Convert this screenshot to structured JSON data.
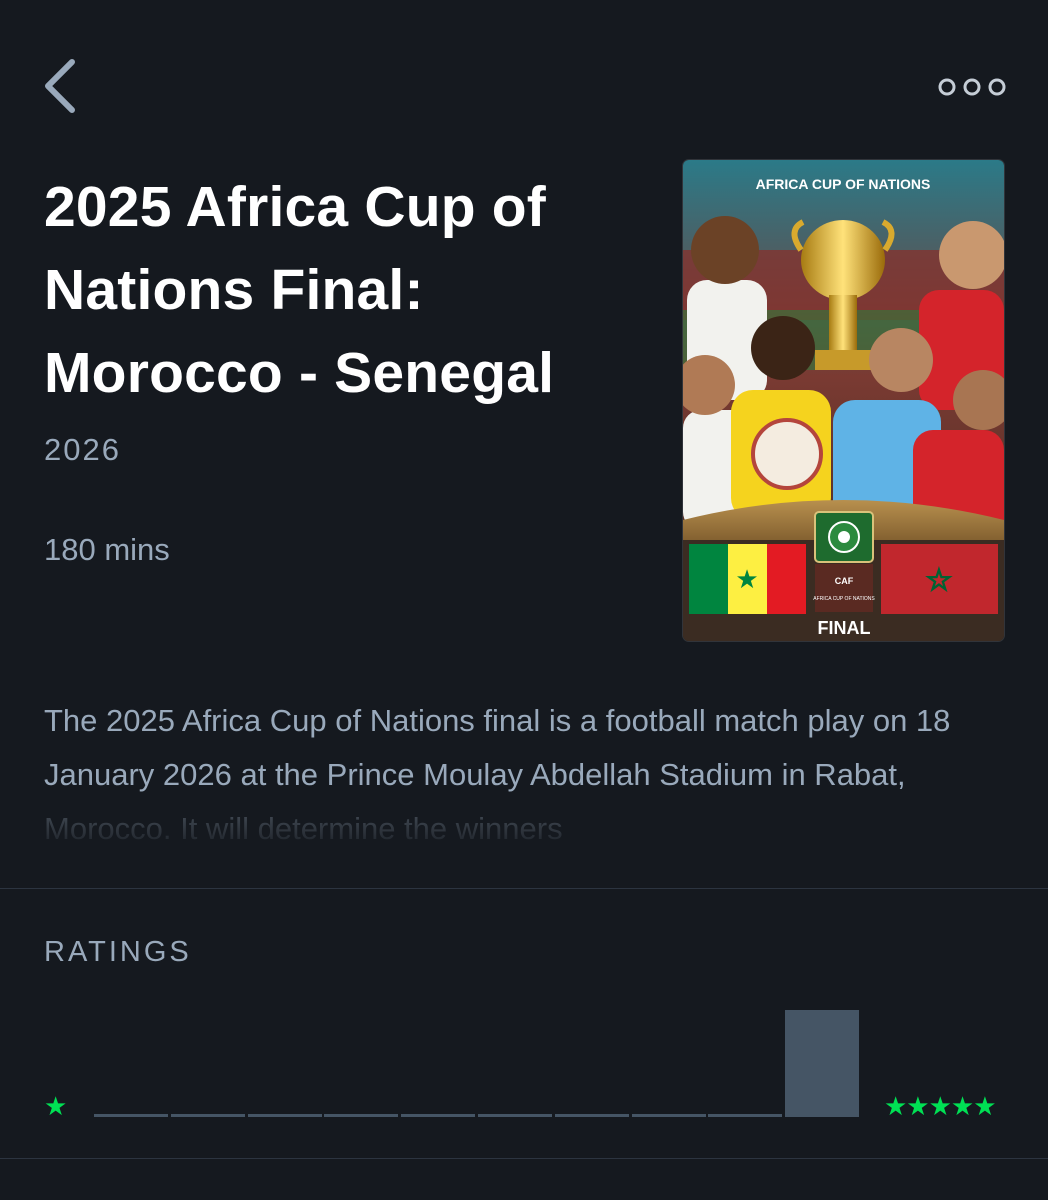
{
  "header": {
    "back_icon": "chevron-left-icon",
    "more_icon": "more-horizontal-icon"
  },
  "film": {
    "title": "2025 Africa Cup of Nations Final: Morocco - Senegal",
    "year": "2026",
    "runtime": "180 mins",
    "synopsis": "The 2025 Africa Cup of Nations final is a football match play on 18 January 2026 at the Prince Moulay Abdellah Stadium in Rabat, Morocco. It will determine the winners"
  },
  "poster": {
    "header_text": "AFRICA CUP OF NATIONS",
    "badge_text": "AFRICA CUP OF NATIONS",
    "badge_org": "CAF",
    "footer_text": "FINAL",
    "flag_left": "senegal",
    "flag_right": "morocco",
    "colors": {
      "senegal_green": "#00853f",
      "senegal_yellow": "#fdef42",
      "senegal_red": "#e31b23",
      "morocco_red": "#c1272d",
      "morocco_green": "#006233"
    }
  },
  "ratings": {
    "heading": "RATINGS",
    "min_label": "★",
    "max_label": "★★★★★",
    "histogram_levels": [
      0,
      0,
      0,
      0,
      0,
      0,
      0,
      0,
      0,
      1
    ],
    "colors": {
      "bar": "#455565",
      "star": "#00e054"
    }
  }
}
